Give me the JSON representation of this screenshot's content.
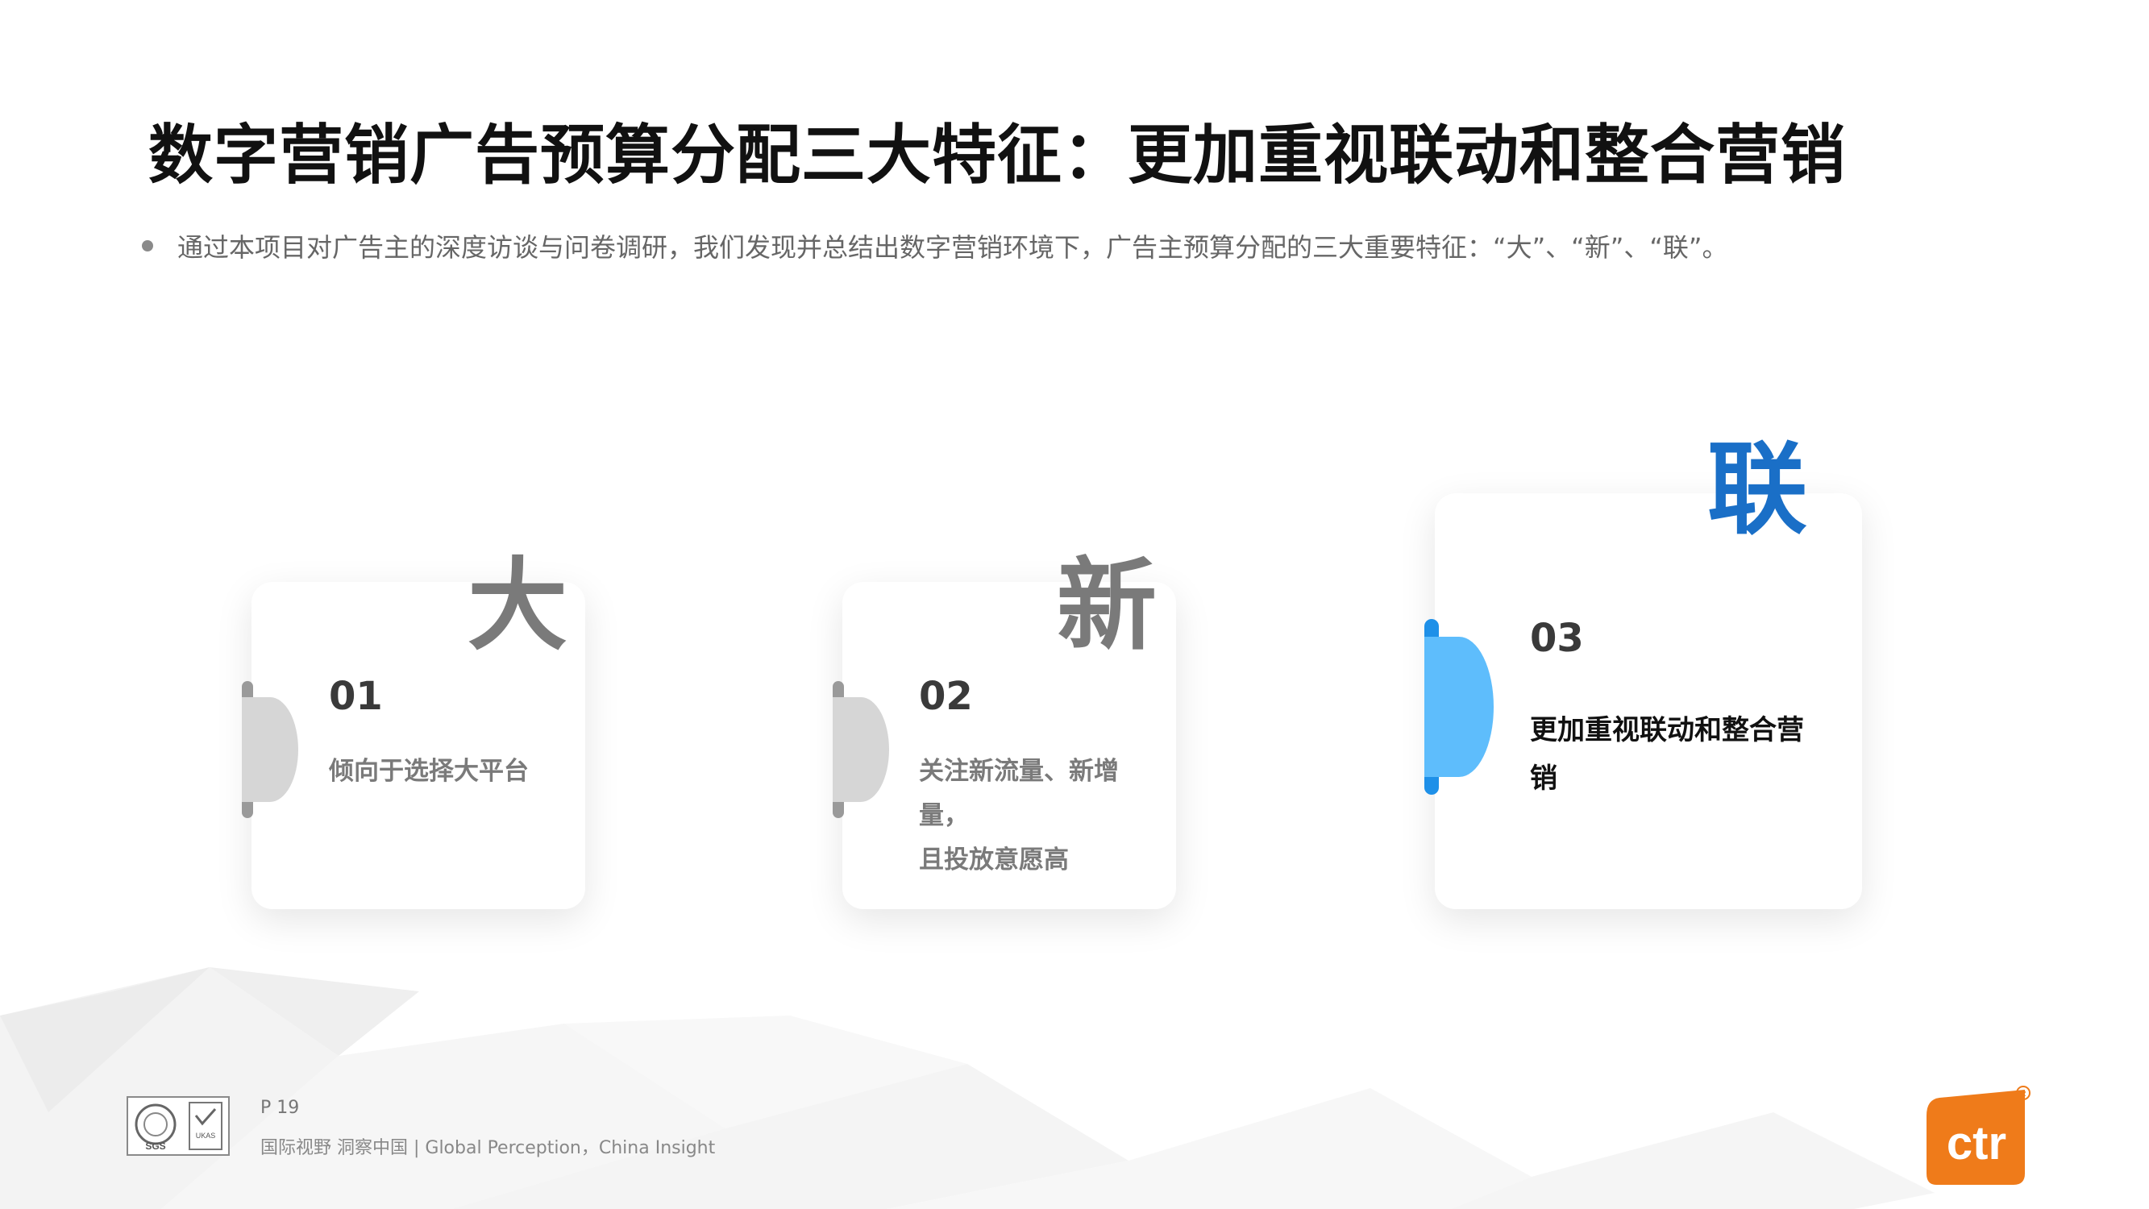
{
  "slide": {
    "title": "数字营销广告预算分配三大特征：更加重视联动和整合营销",
    "bullet": "通过本项目对广告主的深度访谈与问卷调研，我们发现并总结出数字营销环境下，广告主预算分配的三大重要特征：“大”、“新”、“联”。"
  },
  "cards": [
    {
      "char": "大",
      "number": "01",
      "lines": [
        "倾向于选择大平台"
      ]
    },
    {
      "char": "新",
      "number": "02",
      "lines": [
        "关注新流量、新增",
        "量，",
        "且投放意愿高"
      ]
    },
    {
      "char": "联",
      "number": "03",
      "lines": [
        "更加重视联动和整合营销"
      ]
    }
  ],
  "footer": {
    "page": "P 19",
    "tagline": "国际视野  洞察中国 |  Global Perception，China Insight",
    "cert_logo_text": [
      "SGS",
      "UKAS"
    ],
    "brand_logo_text": "ctr",
    "brand_mark": "®"
  },
  "colors": {
    "accent_blue": "#1a6fc7",
    "card3_disc": "#5ebdfc",
    "card3_bar": "#1e90e8",
    "grey_disc": "#d6d6d6",
    "grey_bar": "#9a9a9a",
    "ctr_orange": "#ef7b1a"
  }
}
